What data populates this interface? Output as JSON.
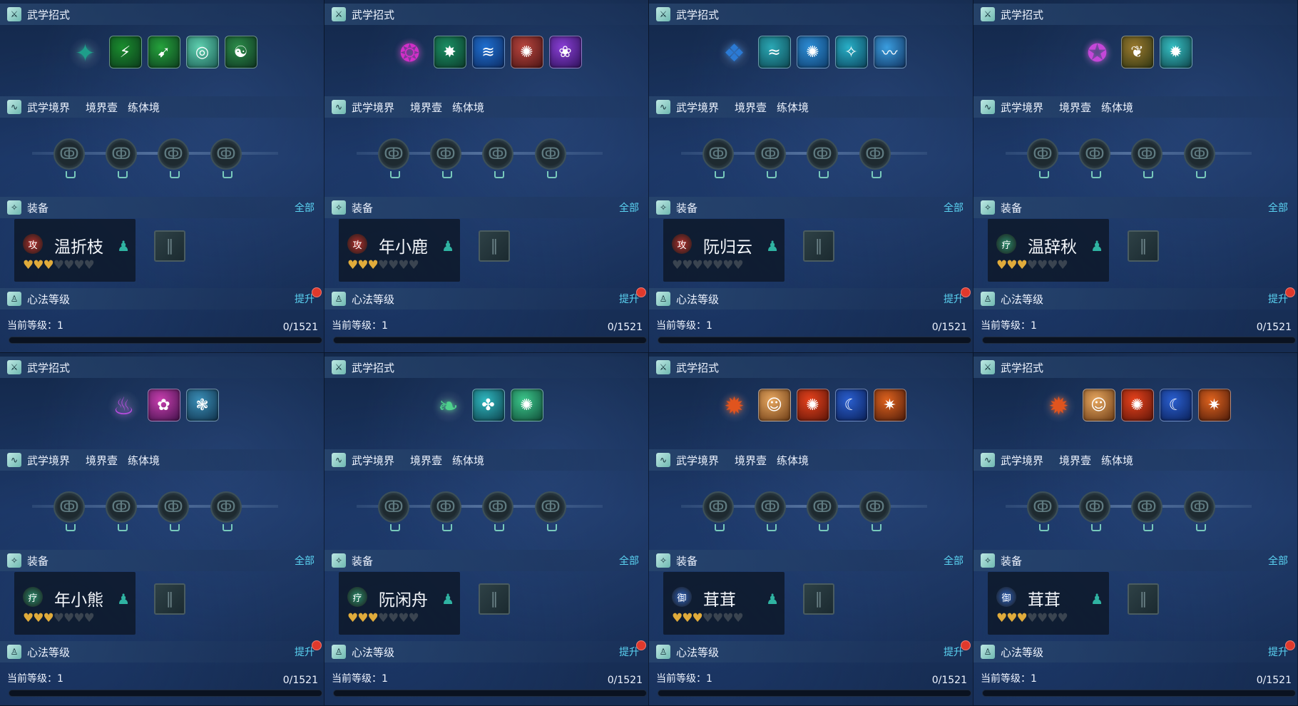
{
  "labels": {
    "skills_header": "武学招式",
    "realm_header": "武学境界",
    "realm_level": "境界壹",
    "realm_stage": "练体境",
    "equip_header": "装备",
    "equip_all": "全部",
    "mind_header": "心法等级",
    "mind_upgrade": "提升",
    "current_level_label": "当前等级：1"
  },
  "panels": [
    {
      "name": "温折枝",
      "role": "攻",
      "role_color": "#b5312d",
      "hearts": 3,
      "progress": "0/1521",
      "skills": [
        {
          "icon": "✦",
          "colors": [
            "#1e9e8a",
            "#0b3b42"
          ],
          "big": true
        },
        {
          "icon": "⚡",
          "colors": [
            "#1a8d2e",
            "#0c3a1c"
          ]
        },
        {
          "icon": "➹",
          "colors": [
            "#25a33c",
            "#0d3d1e"
          ]
        },
        {
          "icon": "◎",
          "colors": [
            "#5fd1b0",
            "#1a5a52"
          ]
        },
        {
          "icon": "☯",
          "colors": [
            "#2c8d4a",
            "#0e3320"
          ]
        }
      ]
    },
    {
      "name": "年小鹿",
      "role": "攻",
      "role_color": "#b5312d",
      "hearts": 3,
      "progress": "0/1521",
      "skills": [
        {
          "icon": "❂",
          "colors": [
            "#d12fc8",
            "#3a0f48"
          ],
          "big": true
        },
        {
          "icon": "✸",
          "colors": [
            "#1b8f64",
            "#0c3a2a"
          ]
        },
        {
          "icon": "≋",
          "colors": [
            "#1e6fd0",
            "#0d2a60"
          ]
        },
        {
          "icon": "✺",
          "colors": [
            "#b8453e",
            "#4a1414"
          ]
        },
        {
          "icon": "❀",
          "colors": [
            "#8a3fd6",
            "#2d1158"
          ]
        }
      ]
    },
    {
      "name": "阮归云",
      "role": "攻",
      "role_color": "#b5312d",
      "hearts": 0,
      "progress": "0/1521",
      "skills": [
        {
          "icon": "❖",
          "colors": [
            "#2b7ad4",
            "#0c2a5a"
          ],
          "big": true
        },
        {
          "icon": "≈",
          "colors": [
            "#2aa8b5",
            "#0d4550"
          ]
        },
        {
          "icon": "✺",
          "colors": [
            "#2d8fd8",
            "#0d3a68"
          ]
        },
        {
          "icon": "✧",
          "colors": [
            "#28b0c8",
            "#0b4058"
          ]
        },
        {
          "icon": "〰",
          "colors": [
            "#3a9ee0",
            "#10305c"
          ]
        }
      ]
    },
    {
      "name": "温辞秋",
      "role": "疗",
      "role_color": "#2b8a6b",
      "hearts": 3,
      "progress": "0/1521",
      "skills": [
        {
          "icon": "✪",
          "colors": [
            "#c447d8",
            "#3b1150"
          ],
          "big": true
        },
        {
          "icon": "❦",
          "colors": [
            "#9a7a2e",
            "#2e3412"
          ]
        },
        {
          "icon": "✹",
          "colors": [
            "#36c0c4",
            "#0e4248"
          ]
        }
      ]
    },
    {
      "name": "年小熊",
      "role": "疗",
      "role_color": "#2b8a6b",
      "hearts": 3,
      "progress": "0/1521",
      "skills": [
        {
          "icon": "♨",
          "colors": [
            "#b84de0",
            "#3b1466"
          ],
          "big": true
        },
        {
          "icon": "✿",
          "colors": [
            "#c93fb0",
            "#3f1048"
          ]
        },
        {
          "icon": "❃",
          "colors": [
            "#3a8fb8",
            "#0f2f48"
          ]
        }
      ]
    },
    {
      "name": "阮闲舟",
      "role": "疗",
      "role_color": "#2b8a6b",
      "hearts": 3,
      "progress": "0/1521",
      "skills": [
        {
          "icon": "❧",
          "colors": [
            "#4ed18c",
            "#0e4030"
          ],
          "big": true
        },
        {
          "icon": "✤",
          "colors": [
            "#2fb8c0",
            "#0c3e48"
          ]
        },
        {
          "icon": "✺",
          "colors": [
            "#3cc88c",
            "#0f4a36"
          ]
        }
      ]
    },
    {
      "name": "茸茸",
      "role": "御",
      "role_color": "#2c5fb8",
      "hearts": 3,
      "progress": "0/1521",
      "skills": [
        {
          "icon": "✹",
          "colors": [
            "#e0541e",
            "#4a1208"
          ],
          "big": true
        },
        {
          "icon": "☺",
          "colors": [
            "#e8a860",
            "#6a3a14"
          ]
        },
        {
          "icon": "✺",
          "colors": [
            "#e8421c",
            "#5a1408"
          ]
        },
        {
          "icon": "☾",
          "colors": [
            "#2a5fd0",
            "#0a1f55"
          ]
        },
        {
          "icon": "✷",
          "colors": [
            "#e0631e",
            "#4a1a0a"
          ]
        }
      ]
    },
    {
      "name": "茸茸",
      "role": "御",
      "role_color": "#2c5fb8",
      "hearts": 3,
      "progress": "0/1521",
      "skills": [
        {
          "icon": "✹",
          "colors": [
            "#e0541e",
            "#4a1208"
          ],
          "big": true
        },
        {
          "icon": "☺",
          "colors": [
            "#e8a860",
            "#6a3a14"
          ]
        },
        {
          "icon": "✺",
          "colors": [
            "#e8421c",
            "#5a1408"
          ]
        },
        {
          "icon": "☾",
          "colors": [
            "#2a5fd0",
            "#0a1f55"
          ]
        },
        {
          "icon": "✷",
          "colors": [
            "#e0631e",
            "#4a1a0a"
          ]
        }
      ]
    }
  ]
}
